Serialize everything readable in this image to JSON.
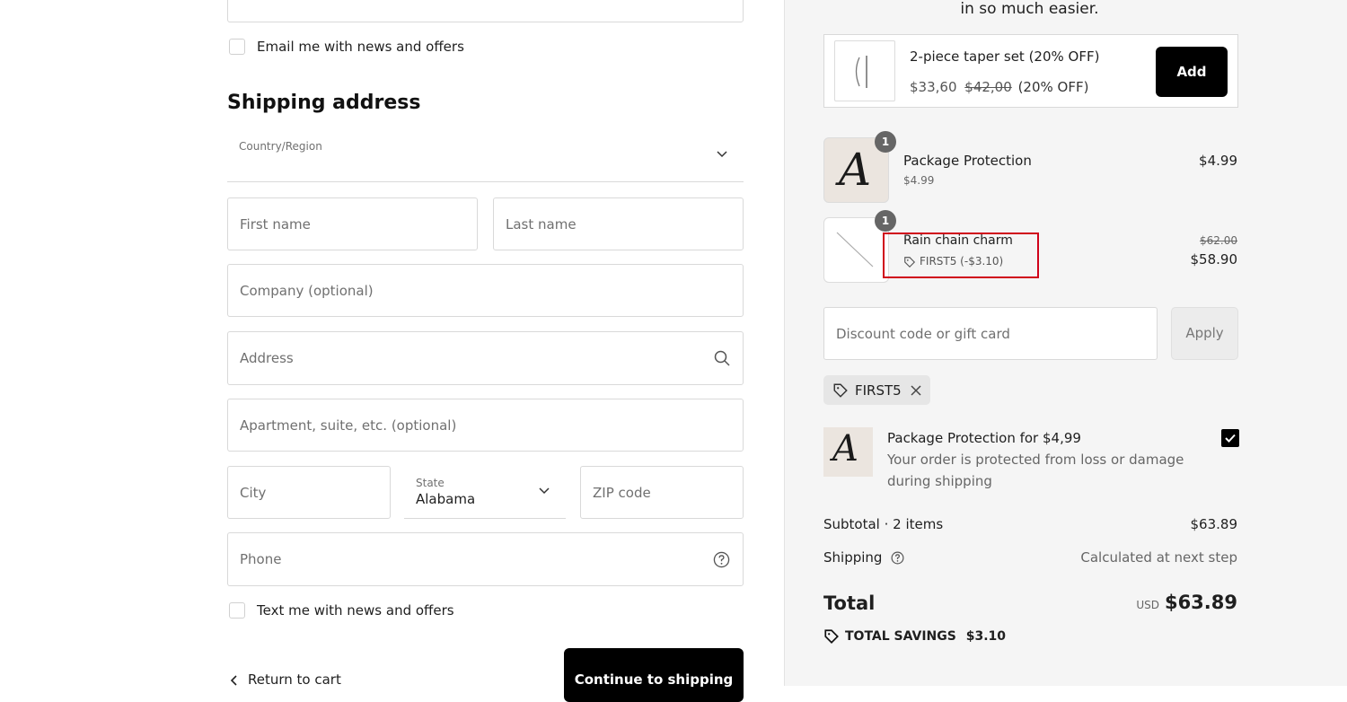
{
  "contact": {
    "email_offers_label": "Email me with news and offers"
  },
  "shipping": {
    "title": "Shipping address",
    "country_label": "Country/Region",
    "first_name_placeholder": "First name",
    "last_name_placeholder": "Last name",
    "company_placeholder": "Company (optional)",
    "address_placeholder": "Address",
    "apartment_placeholder": "Apartment, suite, etc. (optional)",
    "city_placeholder": "City",
    "state_label": "State",
    "state_value": "Alabama",
    "zip_placeholder": "ZIP code",
    "phone_placeholder": "Phone",
    "text_offers_label": "Text me with news and offers",
    "return_label": "Return to cart",
    "continue_label": "Continue to shipping"
  },
  "summary": {
    "top_text": "in so much easier.",
    "upsell": {
      "name": "2-piece taper set (20% OFF)",
      "price": "$33,60",
      "compare_price": "$42,00",
      "discount_note": "(20% OFF)",
      "add_label": "Add"
    },
    "items": [
      {
        "qty": "1",
        "name": "Package Protection",
        "sub": "$4.99",
        "price": "$4.99"
      },
      {
        "qty": "1",
        "name": "Rain chain charm",
        "discount": "FIRST5 (-$3.10)",
        "compare_price": "$62.00",
        "price": "$58.90"
      }
    ],
    "discount_placeholder": "Discount code or gift card",
    "apply_label": "Apply",
    "applied_code": "FIRST5",
    "protection": {
      "title": "Package Protection for $4,99",
      "desc_line1": "Your order is protected from loss or damage",
      "desc_line2": "during shipping"
    },
    "subtotal_label": "Subtotal · 2 items",
    "subtotal_value": "$63.89",
    "shipping_label": "Shipping",
    "shipping_value": "Calculated at next step",
    "total_label": "Total",
    "currency": "USD",
    "total_value": "$63.89",
    "savings_label": "TOTAL SAVINGS",
    "savings_value": "$3.10"
  },
  "colors": {
    "highlight_box": "#d0021b",
    "button_dark": "#000000"
  }
}
